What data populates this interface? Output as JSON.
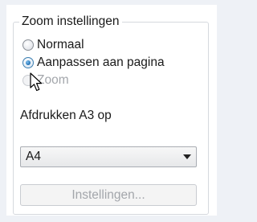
{
  "zoom_group": {
    "title": "Zoom instellingen",
    "options": [
      {
        "label": "Normaal",
        "checked": false,
        "disabled": false
      },
      {
        "label": "Aanpassen aan pagina",
        "checked": true,
        "disabled": false
      },
      {
        "label": "Zoom",
        "checked": false,
        "disabled": true
      }
    ]
  },
  "print_label": "Afdrukken A3 op",
  "paper_select": {
    "value": "A4"
  },
  "settings_button": {
    "label": "Instellingen...",
    "disabled": true
  },
  "colors": {
    "accent": "#1f6fb2",
    "disabled_text": "#a3a6ab",
    "page_background": "#eef1f6"
  }
}
